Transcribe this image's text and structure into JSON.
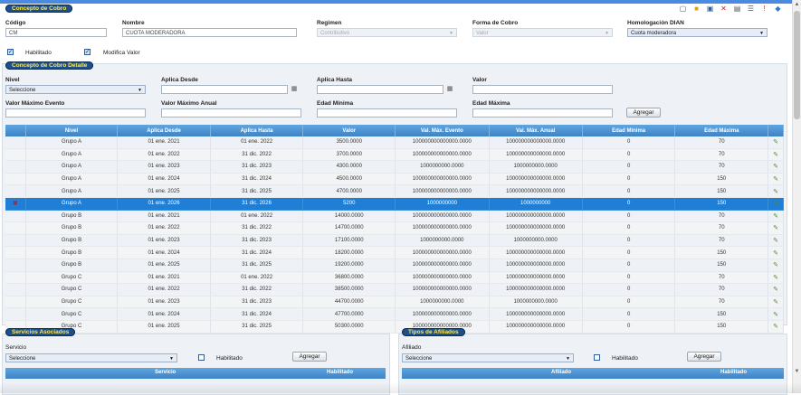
{
  "toolbar": {
    "icons": [
      "page-icon",
      "folder-icon",
      "save-icon",
      "close-icon",
      "print-icon",
      "list-icon",
      "info-icon",
      "chat-icon"
    ]
  },
  "concepto": {
    "section_title": "Concepto de Cobro",
    "codigo_label": "Código",
    "codigo_value": "CM",
    "nombre_label": "Nombre",
    "nombre_value": "CUOTA MODERADORA",
    "regimen_label": "Regimen",
    "regimen_value": "Contributivo",
    "forma_label": "Forma de Cobro",
    "forma_value": "Valor",
    "homologacion_label": "Homologación DIAN",
    "homologacion_value": "Cuota moderadora",
    "habilitado_label": "Habilitado",
    "modifica_label": "Modifica Valor"
  },
  "detalle": {
    "section_title": "Concepto de Cobro Detalle",
    "nivel_label": "Nivel",
    "nivel_value": "Seleccione",
    "aplica_desde_label": "Aplica Desde",
    "aplica_hasta_label": "Aplica Hasta",
    "valor_label": "Valor",
    "valor_max_evento_label": "Valor Máximo Evento",
    "valor_max_anual_label": "Valor Máximo Anual",
    "edad_min_label": "Edad Mínima",
    "edad_max_label": "Edad Máxima",
    "agregar_label": "Agregar",
    "columns": [
      "Nivel",
      "Aplica Desde",
      "Aplica Hasta",
      "Valor",
      "Val. Máx. Evento",
      "Val. Máx. Anual",
      "Edad Mínima",
      "Edad Máxima"
    ],
    "rows": [
      [
        "Grupo A",
        "01 ene. 2021",
        "01 ene. 2022",
        "3500.0000",
        "100000000000000.0000",
        "100000000000000.0000",
        "0",
        "70"
      ],
      [
        "Grupo A",
        "01 ene. 2022",
        "31 dic. 2022",
        "3700.0000",
        "100000000000000.0000",
        "100000000000000.0000",
        "0",
        "70"
      ],
      [
        "Grupo A",
        "01 ene. 2023",
        "31 dic. 2023",
        "4300.0000",
        "1000000000.0000",
        "1000000000.0000",
        "0",
        "70"
      ],
      [
        "Grupo A",
        "01 ene. 2024",
        "31 dic. 2024",
        "4500.0000",
        "100000000000000.0000",
        "100000000000000.0000",
        "0",
        "150"
      ],
      [
        "Grupo A",
        "01 ene. 2025",
        "31 dic. 2025",
        "4700.0000",
        "100000000000000.0000",
        "100000000000000.0000",
        "0",
        "150"
      ],
      [
        "Grupo A",
        "01 ene. 2026",
        "31 dic. 2026",
        "5200",
        "1000000000",
        "1000000000",
        "0",
        "150"
      ],
      [
        "Grupo B",
        "01 ene. 2021",
        "01 ene. 2022",
        "14000.0000",
        "100000000000000.0000",
        "100000000000000.0000",
        "0",
        "70"
      ],
      [
        "Grupo B",
        "01 ene. 2022",
        "31 dic. 2022",
        "14700.0000",
        "100000000000000.0000",
        "100000000000000.0000",
        "0",
        "70"
      ],
      [
        "Grupo B",
        "01 ene. 2023",
        "31 dic. 2023",
        "17100.0000",
        "1000000000.0000",
        "1000000000.0000",
        "0",
        "70"
      ],
      [
        "Grupo B",
        "01 ene. 2024",
        "31 dic. 2024",
        "18200.0000",
        "100000000000000.0000",
        "100000000000000.0000",
        "0",
        "150"
      ],
      [
        "Grupo B",
        "01 ene. 2025",
        "31 dic. 2025",
        "19200.0000",
        "100000000000000.0000",
        "100000000000000.0000",
        "0",
        "150"
      ],
      [
        "Grupo C",
        "01 ene. 2021",
        "01 ene. 2022",
        "36800.0000",
        "100000000000000.0000",
        "100000000000000.0000",
        "0",
        "70"
      ],
      [
        "Grupo C",
        "01 ene. 2022",
        "31 dic. 2022",
        "38500.0000",
        "100000000000000.0000",
        "100000000000000.0000",
        "0",
        "70"
      ],
      [
        "Grupo C",
        "01 ene. 2023",
        "31 dic. 2023",
        "44700.0000",
        "1000000000.0000",
        "1000000000.0000",
        "0",
        "70"
      ],
      [
        "Grupo C",
        "01 ene. 2024",
        "31 dic. 2024",
        "47700.0000",
        "100000000000000.0000",
        "100000000000000.0000",
        "0",
        "150"
      ],
      [
        "Grupo C",
        "01 ene. 2025",
        "31 dic. 2025",
        "50300.0000",
        "100000000000000.0000",
        "100000000000000.0000",
        "0",
        "150"
      ]
    ],
    "selected_row": 5
  },
  "servicios": {
    "section_title": "Servicios Asociados",
    "servicio_label": "Servicio",
    "servicio_value": "Seleccione",
    "habilitado_label": "Habilitado",
    "agregar_label": "Agregar",
    "col_servicio": "Servicio",
    "col_habilitado": "Habilitado"
  },
  "afiliados": {
    "section_title": "Tipos de Afiliados",
    "afiliado_label": "Afiliado",
    "afiliado_value": "Seleccione",
    "habilitado_label": "Habilitado",
    "agregar_label": "Agregar",
    "col_afiliado": "Afiliado",
    "col_habilitado": "Habilitado"
  }
}
